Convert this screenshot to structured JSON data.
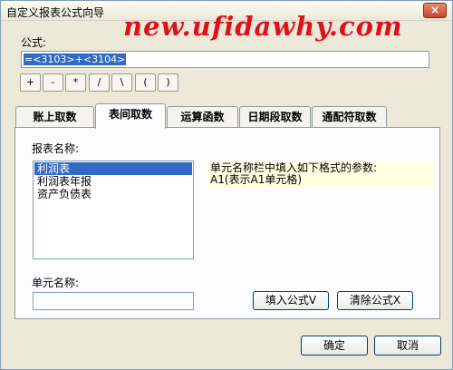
{
  "window": {
    "title": "自定义报表公式向导",
    "close_label": "×",
    "watermark": "new.ufidawhy.com"
  },
  "formula": {
    "label": "公式:",
    "value": "=<3103>+<3104>"
  },
  "operators": [
    "+",
    "-",
    "*",
    "/",
    "\\",
    "(",
    ")"
  ],
  "tabs": [
    {
      "label": "账上取数",
      "active": false
    },
    {
      "label": "表间取数",
      "active": true
    },
    {
      "label": "运算函数",
      "active": false
    },
    {
      "label": "日期段取数",
      "active": false
    },
    {
      "label": "通配符取数",
      "active": false
    }
  ],
  "panel": {
    "report_label": "报表名称:",
    "reports": [
      {
        "label": "利润表",
        "selected": true
      },
      {
        "label": "利润表年报",
        "selected": false
      },
      {
        "label": "资产负债表",
        "selected": false
      }
    ],
    "hint_lines": [
      "单元名称栏中填入如下格式的参数:",
      "A1(表示A1单元格)"
    ],
    "cell_label": "单元名称:",
    "cell_value": "",
    "insert_label": "填入公式V",
    "clear_label": "清除公式X"
  },
  "footer": {
    "ok_label": "确定",
    "cancel_label": "取消"
  }
}
